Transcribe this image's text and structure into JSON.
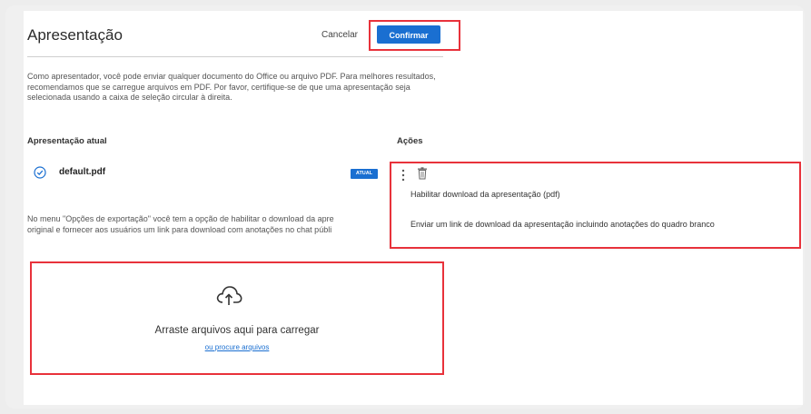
{
  "dialog": {
    "title": "Apresentação",
    "cancel_label": "Cancelar",
    "confirm_label": "Confirmar",
    "description": "Como apresentador, você pode enviar qualquer documento do Office ou arquivo PDF. Para melhores resultados, recomendamos que se carregue arquivos em PDF. Por favor, certifique-se de que uma apresentação seja selecionada usando a caixa de seleção circular à direita."
  },
  "table": {
    "current_header": "Apresentação atual",
    "actions_header": "Ações",
    "file": {
      "name": "default.pdf",
      "badge": "ATUAL"
    }
  },
  "export_note": {
    "line1": "No menu \"Opções de exportação\" você tem a opção de habilitar o download da apre",
    "line2": "original e fornecer aos usuários um link para download com anotações no chat públi"
  },
  "actions_menu": {
    "items": [
      {
        "label": "Habilitar download da apresentação (pdf)"
      },
      {
        "label": "Enviar um link de download da apresentação incluindo anotações do quadro branco"
      }
    ]
  },
  "upload": {
    "title": "Arraste arquivos aqui para carregar",
    "browse_link": "ou procure arquivos"
  },
  "colors": {
    "accent": "#1a6fd1",
    "highlight": "#e8323b"
  },
  "icons": {
    "check": "check-circle-icon",
    "kebab": "kebab-menu-icon",
    "trash": "trash-icon",
    "upload": "cloud-upload-icon"
  }
}
